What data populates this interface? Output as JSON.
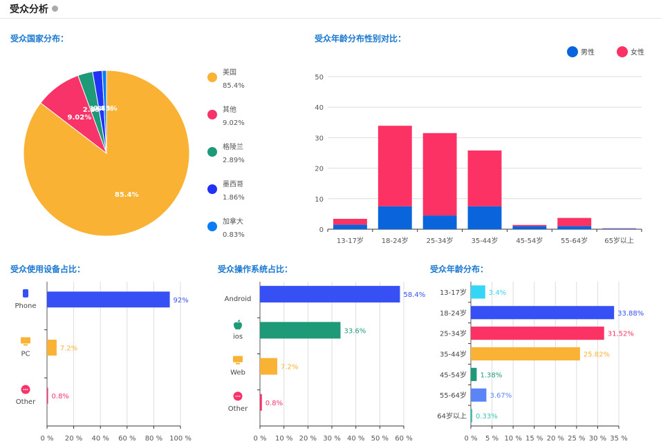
{
  "header": {
    "title": "受众分析",
    "info_icon": "info-icon"
  },
  "chart_data": [
    {
      "id": "country",
      "type": "pie",
      "title": "受众国家分布：",
      "slices": [
        {
          "label": "美国",
          "value": 85.4,
          "display": "85.4%",
          "color": "#f9b233"
        },
        {
          "label": "其他",
          "value": 9.02,
          "display": "9.02%",
          "color": "#f7336a"
        },
        {
          "label": "格陵兰",
          "value": 2.89,
          "display": "2.89%",
          "color": "#1f9a78"
        },
        {
          "label": "墨西哥",
          "value": 1.86,
          "display": "1.86%",
          "color": "#2233f5"
        },
        {
          "label": "加拿大",
          "value": 0.83,
          "display": "0.83%",
          "color": "#0a7cf5"
        }
      ],
      "legend": "right"
    },
    {
      "id": "gender",
      "type": "bar",
      "stacked": true,
      "title": "受众年龄分布性别对比：",
      "categories": [
        "13-17岁",
        "18-24岁",
        "25-34岁",
        "35-44岁",
        "45-54岁",
        "55-64岁",
        "65岁以上"
      ],
      "series": [
        {
          "name": "男性",
          "color": "#0a64dc",
          "values": [
            1.5,
            7.5,
            4.5,
            7.5,
            1,
            1,
            0.2
          ]
        },
        {
          "name": "女性",
          "color": "#fb3263",
          "values": [
            1.9,
            26.4,
            27,
            18.3,
            0.4,
            2.7,
            0.1
          ]
        }
      ],
      "ylim": [
        0,
        50
      ],
      "yticks": [
        0,
        10,
        20,
        30,
        40,
        50
      ],
      "grid": true,
      "legend": "top-right"
    },
    {
      "id": "device",
      "type": "bar",
      "orientation": "horizontal",
      "title": "受众使用设备占比：",
      "categories": [
        "Phone",
        "PC",
        "Other"
      ],
      "icons": [
        "phone-icon",
        "monitor-icon",
        "more-icon"
      ],
      "values": [
        92,
        7.2,
        0.8
      ],
      "labels": [
        "92%",
        "7.2%",
        "0.8%"
      ],
      "colors": [
        "#3650f5",
        "#f9b233",
        "#f7336a"
      ],
      "xlim": [
        0,
        100
      ],
      "xticks": [
        "0 %",
        "20 %",
        "40 %",
        "60 %",
        "80 %",
        "100 %"
      ],
      "grid": true
    },
    {
      "id": "os",
      "type": "bar",
      "orientation": "horizontal",
      "title": "受众操作系统占比：",
      "categories": [
        "Android",
        "ios",
        "Web",
        "Other"
      ],
      "icons": [
        null,
        "apple-icon",
        "monitor-icon",
        "more-icon"
      ],
      "values": [
        58.4,
        33.6,
        7.2,
        0.8
      ],
      "labels": [
        "58.4%",
        "33.6%",
        "7.2%",
        "0.8%"
      ],
      "colors": [
        "#3650f5",
        "#1f9a78",
        "#f9b233",
        "#f7336a"
      ],
      "xlim": [
        0,
        60
      ],
      "xticks": [
        "0 %",
        "10 %",
        "20 %",
        "30 %",
        "40 %",
        "50 %",
        "60 %"
      ],
      "grid": true
    },
    {
      "id": "age",
      "type": "bar",
      "orientation": "horizontal",
      "title": "受众年龄分布：",
      "categories": [
        "13-17岁",
        "18-24岁",
        "25-34岁",
        "35-44岁",
        "45-54岁",
        "55-64岁",
        "64岁以上"
      ],
      "values": [
        3.4,
        33.88,
        31.52,
        25.82,
        1.38,
        3.67,
        0.33
      ],
      "labels": [
        "3.4%",
        "33.88%",
        "31.52%",
        "25.82%",
        "1.38%",
        "3.67%",
        "0.33%"
      ],
      "colors": [
        "#33d6f5",
        "#3650f5",
        "#fb3263",
        "#f9b233",
        "#1f9a78",
        "#5b84f7",
        "#3cc3b0"
      ],
      "xlim": [
        0,
        35
      ],
      "xticks": [
        "0 %",
        "5 %",
        "10 %",
        "15 %",
        "20 %",
        "25 %",
        "30 %",
        "35 %"
      ],
      "grid": true
    }
  ]
}
